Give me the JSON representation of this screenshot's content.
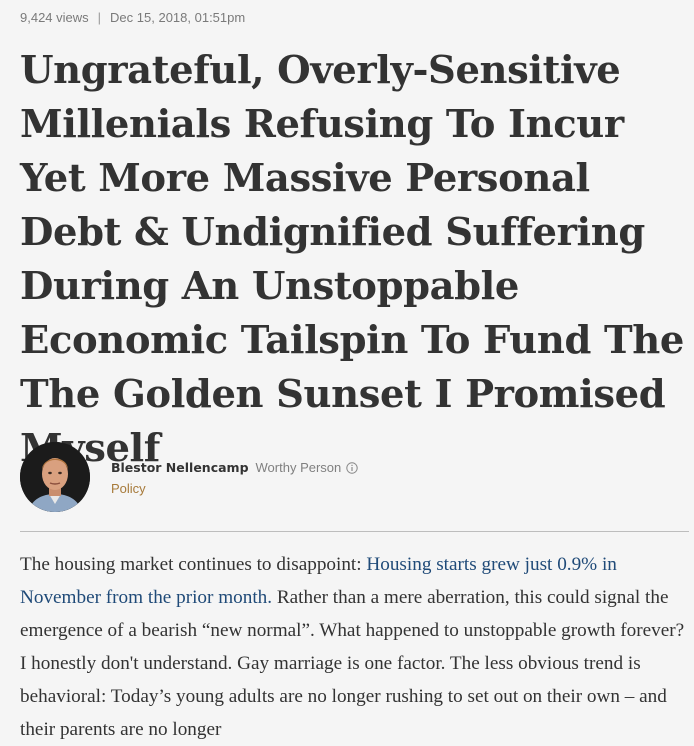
{
  "meta": {
    "views": "9,424 views",
    "separator": "|",
    "date": "Dec 15, 2018, 01:51pm"
  },
  "article": {
    "headline": "Ungrateful, Overly-Sensitive Millenials Refusing To Incur Yet More Massive Personal Debt & Undignified Suffering During An Unstoppable Economic Tailspin To Fund The The Golden Sunset I Promised Myself",
    "author": {
      "name": "Blestor Nellencamp",
      "role": "Worthy Person",
      "category": "Policy",
      "avatar_icon": "author-portrait"
    },
    "body": {
      "intro": "The housing market continues to disappoint: ",
      "link_text": "Housing starts grew just 0.9% in November from the prior month.",
      "rest": " Rather than a mere aberration, this could signal the emergence of a bearish “new normal”. What happened to unstoppable growth forever? I honestly don't understand. Gay marriage is one factor. The less obvious trend is behavioral: Today’s young adults are no longer rushing to set out on their own – and their parents are no longer"
    }
  },
  "colors": {
    "background": "#f5f5f5",
    "link": "#1f4a78",
    "category": "#a77a3a",
    "meta": "#7a7a7a"
  }
}
